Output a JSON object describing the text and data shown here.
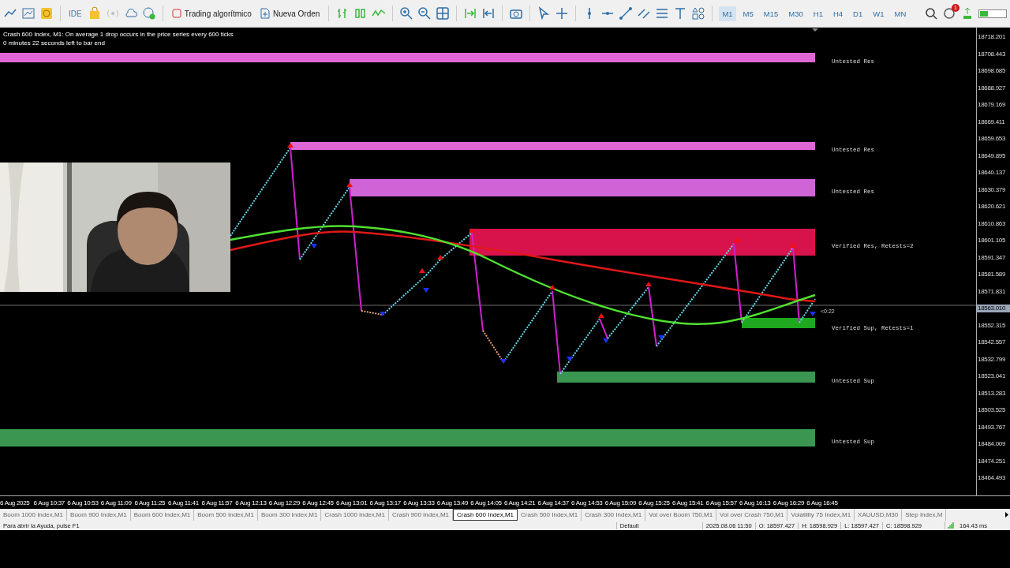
{
  "toolbar": {
    "ide_label": "IDE",
    "buttons": [
      "Trading algorítmico",
      "Nueva Orden"
    ],
    "timeframes": [
      {
        "label": "M1",
        "selected": true
      },
      {
        "label": "M5",
        "selected": false
      },
      {
        "label": "M15",
        "selected": false
      },
      {
        "label": "M30",
        "selected": false
      },
      {
        "label": "H1",
        "selected": false
      },
      {
        "label": "H4",
        "selected": false
      },
      {
        "label": "D1",
        "selected": false
      },
      {
        "label": "W1",
        "selected": false
      },
      {
        "label": "MN",
        "selected": false
      }
    ],
    "notification_count": "1"
  },
  "chart": {
    "title": "Crash 600 Index, M1:  On average 1 drop occurs in the price series every 600 ticks",
    "countdown": "0 minutes 22 seconds left to bar end",
    "bar_timer": "<0:22",
    "zones": [
      {
        "label": "Untested Res",
        "color": "#e066d6"
      },
      {
        "label": "Untested Res",
        "color": "#e066d6"
      },
      {
        "label": "Untested Res",
        "color": "#d063d6"
      },
      {
        "label": "Verified Res, Retests=2",
        "color": "#d8134c"
      },
      {
        "label": "Verified Sup, Retests=1",
        "color": "#1fa81f"
      },
      {
        "label": "Untested Sup",
        "color": "#3a9650"
      },
      {
        "label": "Untested Sup",
        "color": "#3a9650"
      }
    ],
    "price_axis": [
      {
        "label": "18718.201",
        "current": false
      },
      {
        "label": "18708.443",
        "current": false
      },
      {
        "label": "18698.685",
        "current": false
      },
      {
        "label": "18688.927",
        "current": false
      },
      {
        "label": "18679.169",
        "current": false
      },
      {
        "label": "18669.411",
        "current": false
      },
      {
        "label": "18659.653",
        "current": false
      },
      {
        "label": "18649.895",
        "current": false
      },
      {
        "label": "18640.137",
        "current": false
      },
      {
        "label": "18630.379",
        "current": false
      },
      {
        "label": "18620.621",
        "current": false
      },
      {
        "label": "18610.863",
        "current": false
      },
      {
        "label": "18601.105",
        "current": false
      },
      {
        "label": "18591.347",
        "current": false
      },
      {
        "label": "18581.589",
        "current": false
      },
      {
        "label": "18571.831",
        "current": false
      },
      {
        "label": "18563.010",
        "current": true
      },
      {
        "label": "18552.315",
        "current": false
      },
      {
        "label": "18542.557",
        "current": false
      },
      {
        "label": "18532.799",
        "current": false
      },
      {
        "label": "18523.041",
        "current": false
      },
      {
        "label": "18513.283",
        "current": false
      },
      {
        "label": "18503.525",
        "current": false
      },
      {
        "label": "18493.767",
        "current": false
      },
      {
        "label": "18484.009",
        "current": false
      },
      {
        "label": "18474.251",
        "current": false
      },
      {
        "label": "18464.493",
        "current": false
      }
    ],
    "time_axis": [
      "6 Aug 2025",
      "6 Aug 10:37",
      "6 Aug 10:53",
      "6 Aug 11:09",
      "6 Aug 11:25",
      "6 Aug 11:41",
      "6 Aug 11:57",
      "6 Aug 12:13",
      "6 Aug 12:29",
      "6 Aug 12:45",
      "6 Aug 13:01",
      "6 Aug 13:17",
      "6 Aug 13:33",
      "6 Aug 13:49",
      "6 Aug 14:05",
      "6 Aug 14:21",
      "6 Aug 14:37",
      "6 Aug 14:53",
      "6 Aug 15:09",
      "6 Aug 15:25",
      "6 Aug 15:41",
      "6 Aug 15:57",
      "6 Aug 16:13",
      "6 Aug 16:29",
      "6 Aug 16:45"
    ]
  },
  "tabs": [
    {
      "label": "Boom 1000 Index,M1",
      "selected": false
    },
    {
      "label": "Boom 900 Index,M1",
      "selected": false
    },
    {
      "label": "Boom 600 Index,M1",
      "selected": false
    },
    {
      "label": "Boom 500 Index,M1",
      "selected": false
    },
    {
      "label": "Boom 300 Index,M1",
      "selected": false
    },
    {
      "label": "Crash 1000 Index,M1",
      "selected": false
    },
    {
      "label": "Crash 900 Index,M1",
      "selected": false
    },
    {
      "label": "Crash 600 Index,M1",
      "selected": true
    },
    {
      "label": "Crash 500 Index,M1",
      "selected": false
    },
    {
      "label": "Crash 300 Index,M1",
      "selected": false
    },
    {
      "label": "Vol over Boom 750,M1",
      "selected": false
    },
    {
      "label": "Vol over Crash 750,M1",
      "selected": false
    },
    {
      "label": "Volatility 75 Index,M1",
      "selected": false
    },
    {
      "label": "XAUUSD,M30",
      "selected": false
    },
    {
      "label": "Step Index,M",
      "selected": false
    }
  ],
  "status_bar": {
    "help": "Para abrir la Ayuda, pulse F1",
    "profile": "Default",
    "datetime": "2025.08.06 11:50",
    "open": "O: 18597.427",
    "high": "H: 18598.929",
    "low": "L: 18597.427",
    "close": "C: 18598.929",
    "ping": "164.43 ms"
  }
}
